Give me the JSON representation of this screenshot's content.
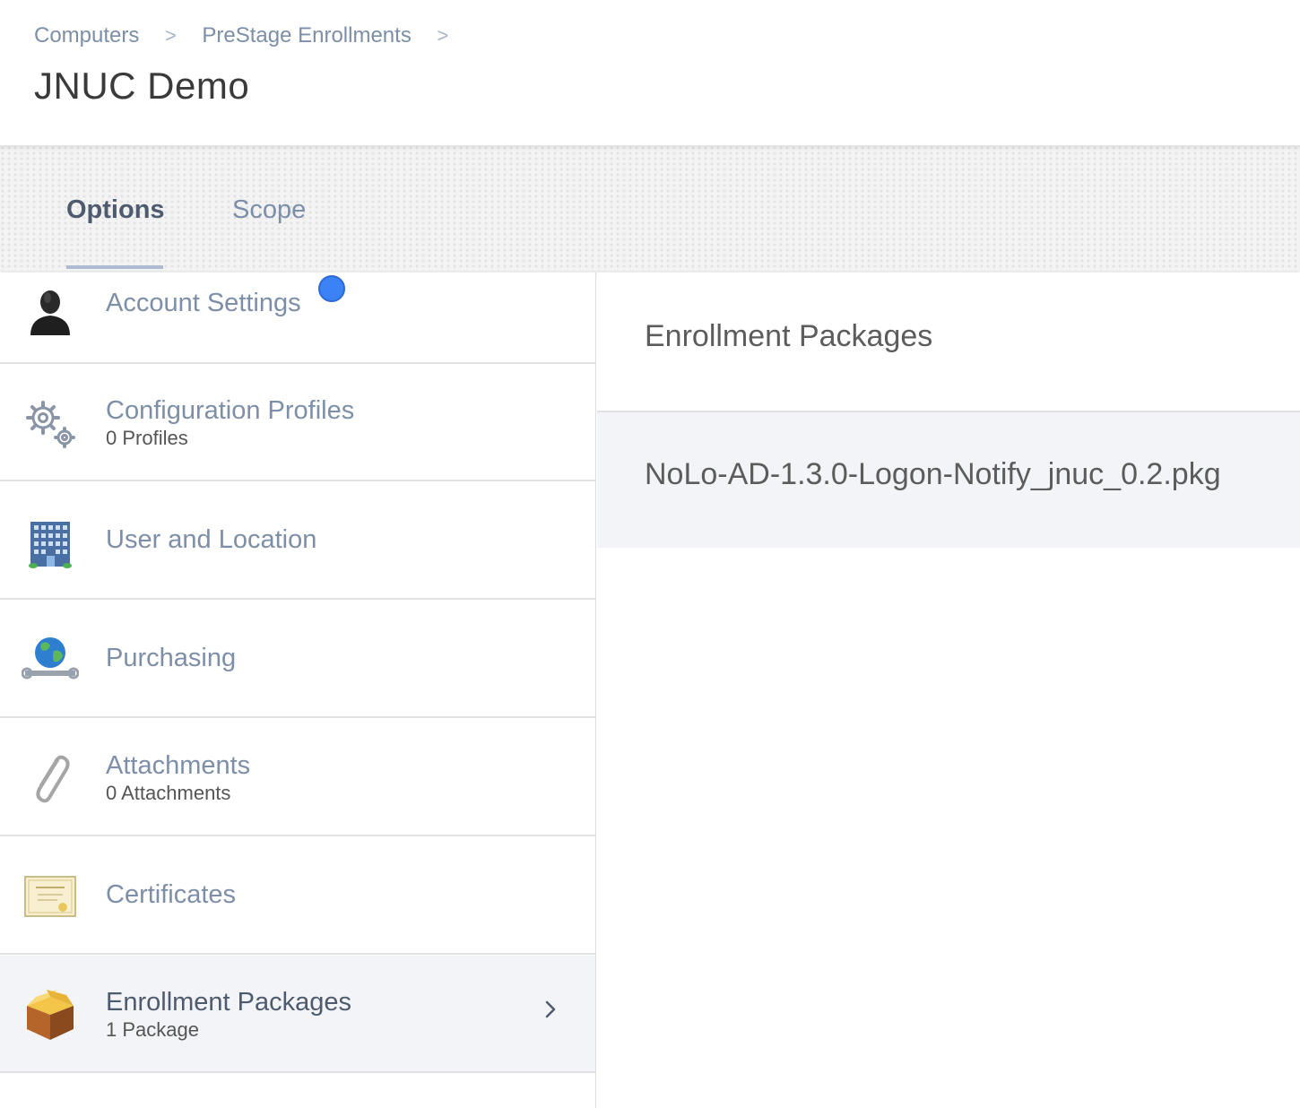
{
  "breadcrumb": {
    "items": [
      "Computers",
      "PreStage Enrollments"
    ],
    "separator": ">"
  },
  "page": {
    "title": "JNUC Demo"
  },
  "tabs": [
    {
      "label": "Options",
      "active": true
    },
    {
      "label": "Scope",
      "active": false
    }
  ],
  "sidebar": {
    "items": [
      {
        "label": "Account Settings",
        "sub": "",
        "icon": "user-silhouette-icon",
        "badge": "notification-dot"
      },
      {
        "label": "Configuration Profiles",
        "sub": "0 Profiles",
        "icon": "gears-icon"
      },
      {
        "label": "User and Location",
        "sub": "",
        "icon": "office-building-icon"
      },
      {
        "label": "Purchasing",
        "sub": "",
        "icon": "globe-wrench-icon"
      },
      {
        "label": "Attachments",
        "sub": "0 Attachments",
        "icon": "paperclip-icon"
      },
      {
        "label": "Certificates",
        "sub": "",
        "icon": "certificate-icon"
      },
      {
        "label": "Enrollment Packages",
        "sub": "1 Package",
        "icon": "package-box-icon",
        "active": true
      }
    ]
  },
  "detail": {
    "title": "Enrollment Packages",
    "packages": [
      "NoLo-AD-1.3.0-Logon-Notify_jnuc_0.2.pkg"
    ]
  },
  "colors": {
    "link": "#7d8fa8",
    "active_text": "#4e5b6e",
    "badge": "#3b82f6",
    "selected_bg": "#f3f4f8"
  }
}
